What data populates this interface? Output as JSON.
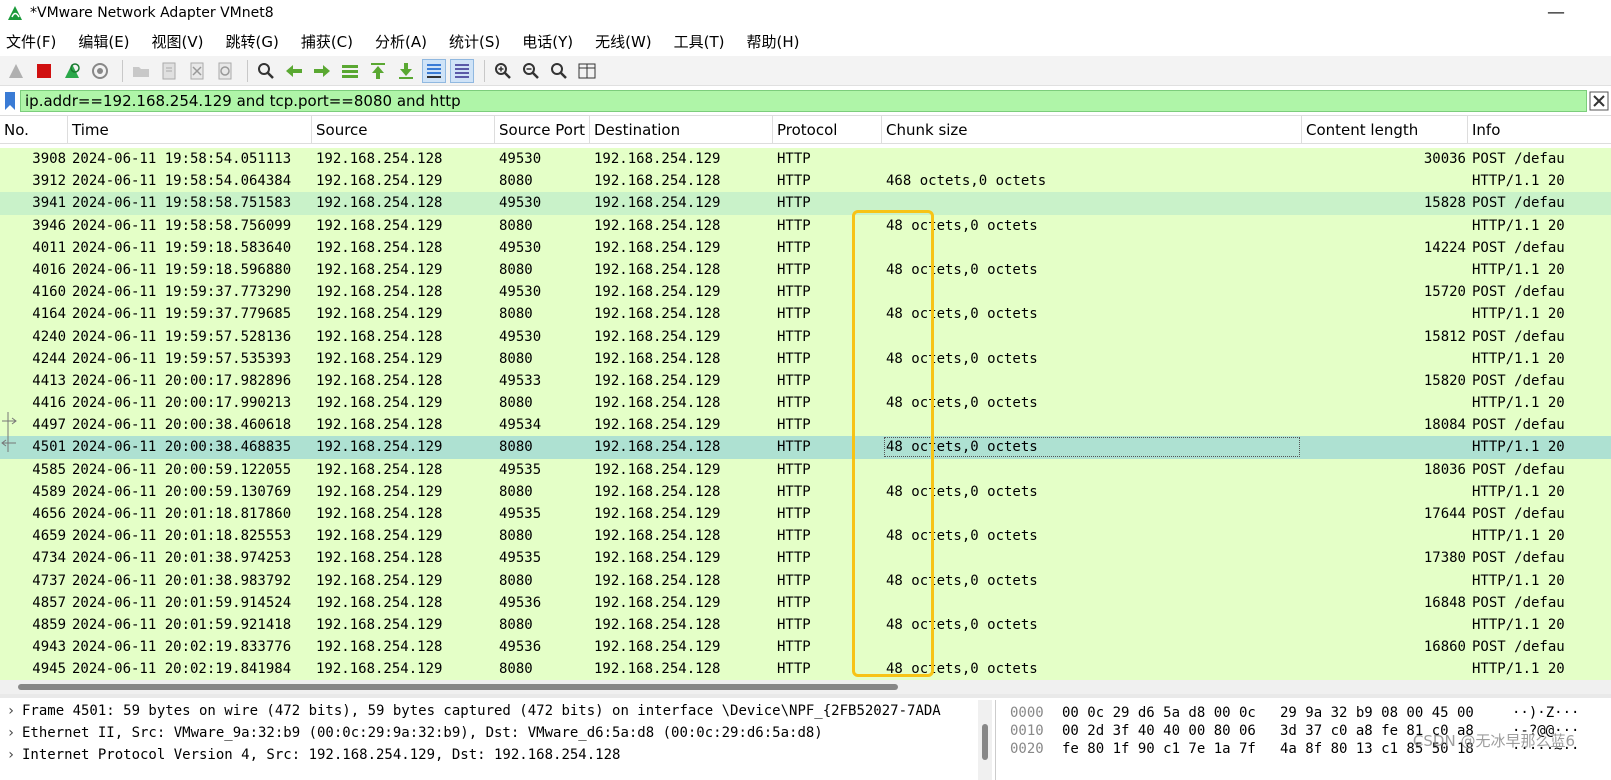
{
  "window": {
    "title": "*VMware Network Adapter VMnet8",
    "minimize": "—"
  },
  "menu": [
    "文件(F)",
    "编辑(E)",
    "视图(V)",
    "跳转(G)",
    "捕获(C)",
    "分析(A)",
    "统计(S)",
    "电话(Y)",
    "无线(W)",
    "工具(T)",
    "帮助(H)"
  ],
  "toolbar_icons": [
    "shark-fin-start-icon",
    "stop-capture-icon",
    "restart-capture-icon",
    "capture-options-icon",
    "open-file-icon",
    "save-file-icon",
    "close-file-icon",
    "reload-file-icon",
    "find-packet-icon",
    "go-back-icon",
    "go-forward-icon",
    "go-to-packet-icon",
    "go-first-icon",
    "go-last-icon",
    "auto-scroll-icon",
    "colorize-icon",
    "zoom-in-icon",
    "zoom-out-icon",
    "zoom-normal-icon",
    "resize-columns-icon"
  ],
  "filter": {
    "value": "ip.addr==192.168.254.129 and tcp.port==8080 and http"
  },
  "columns": {
    "no": "No.",
    "time": "Time",
    "source": "Source",
    "sport": "Source Port",
    "destination": "Destination",
    "protocol": "Protocol",
    "chunk": "Chunk size",
    "clen": "Content length",
    "info": "Info"
  },
  "packets": [
    {
      "no": "3908",
      "time": "2024-06-11 19:58:54.051113",
      "src": "192.168.254.128",
      "sport": "49530",
      "dst": "192.168.254.129",
      "proto": "HTTP",
      "chunk": "",
      "clen": "30036",
      "info": "POST /defau"
    },
    {
      "no": "3912",
      "time": "2024-06-11 19:58:54.064384",
      "src": "192.168.254.129",
      "sport": "8080",
      "dst": "192.168.254.128",
      "proto": "HTTP",
      "chunk": "468 octets,0 octets",
      "clen": "",
      "info": "HTTP/1.1 20"
    },
    {
      "no": "3941",
      "time": "2024-06-11 19:58:58.751583",
      "src": "192.168.254.128",
      "sport": "49530",
      "dst": "192.168.254.129",
      "proto": "HTTP",
      "chunk": "",
      "clen": "15828",
      "info": "POST /defau"
    },
    {
      "no": "3946",
      "time": "2024-06-11 19:58:58.756099",
      "src": "192.168.254.129",
      "sport": "8080",
      "dst": "192.168.254.128",
      "proto": "HTTP",
      "chunk": "48 octets,0 octets",
      "clen": "",
      "info": "HTTP/1.1 20"
    },
    {
      "no": "4011",
      "time": "2024-06-11 19:59:18.583640",
      "src": "192.168.254.128",
      "sport": "49530",
      "dst": "192.168.254.129",
      "proto": "HTTP",
      "chunk": "",
      "clen": "14224",
      "info": "POST /defau"
    },
    {
      "no": "4016",
      "time": "2024-06-11 19:59:18.596880",
      "src": "192.168.254.129",
      "sport": "8080",
      "dst": "192.168.254.128",
      "proto": "HTTP",
      "chunk": "48 octets,0 octets",
      "clen": "",
      "info": "HTTP/1.1 20"
    },
    {
      "no": "4160",
      "time": "2024-06-11 19:59:37.773290",
      "src": "192.168.254.128",
      "sport": "49530",
      "dst": "192.168.254.129",
      "proto": "HTTP",
      "chunk": "",
      "clen": "15720",
      "info": "POST /defau"
    },
    {
      "no": "4164",
      "time": "2024-06-11 19:59:37.779685",
      "src": "192.168.254.129",
      "sport": "8080",
      "dst": "192.168.254.128",
      "proto": "HTTP",
      "chunk": "48 octets,0 octets",
      "clen": "",
      "info": "HTTP/1.1 20"
    },
    {
      "no": "4240",
      "time": "2024-06-11 19:59:57.528136",
      "src": "192.168.254.128",
      "sport": "49530",
      "dst": "192.168.254.129",
      "proto": "HTTP",
      "chunk": "",
      "clen": "15812",
      "info": "POST /defau"
    },
    {
      "no": "4244",
      "time": "2024-06-11 19:59:57.535393",
      "src": "192.168.254.129",
      "sport": "8080",
      "dst": "192.168.254.128",
      "proto": "HTTP",
      "chunk": "48 octets,0 octets",
      "clen": "",
      "info": "HTTP/1.1 20"
    },
    {
      "no": "4413",
      "time": "2024-06-11 20:00:17.982896",
      "src": "192.168.254.128",
      "sport": "49533",
      "dst": "192.168.254.129",
      "proto": "HTTP",
      "chunk": "",
      "clen": "15820",
      "info": "POST /defau"
    },
    {
      "no": "4416",
      "time": "2024-06-11 20:00:17.990213",
      "src": "192.168.254.129",
      "sport": "8080",
      "dst": "192.168.254.128",
      "proto": "HTTP",
      "chunk": "48 octets,0 octets",
      "clen": "",
      "info": "HTTP/1.1 20"
    },
    {
      "no": "4497",
      "time": "2024-06-11 20:00:38.460618",
      "src": "192.168.254.128",
      "sport": "49534",
      "dst": "192.168.254.129",
      "proto": "HTTP",
      "chunk": "",
      "clen": "18084",
      "info": "POST /defau"
    },
    {
      "no": "4501",
      "time": "2024-06-11 20:00:38.468835",
      "src": "192.168.254.129",
      "sport": "8080",
      "dst": "192.168.254.128",
      "proto": "HTTP",
      "chunk": "48 octets,0 octets",
      "clen": "",
      "info": "HTTP/1.1 20"
    },
    {
      "no": "4585",
      "time": "2024-06-11 20:00:59.122055",
      "src": "192.168.254.128",
      "sport": "49535",
      "dst": "192.168.254.129",
      "proto": "HTTP",
      "chunk": "",
      "clen": "18036",
      "info": "POST /defau"
    },
    {
      "no": "4589",
      "time": "2024-06-11 20:00:59.130769",
      "src": "192.168.254.129",
      "sport": "8080",
      "dst": "192.168.254.128",
      "proto": "HTTP",
      "chunk": "48 octets,0 octets",
      "clen": "",
      "info": "HTTP/1.1 20"
    },
    {
      "no": "4656",
      "time": "2024-06-11 20:01:18.817860",
      "src": "192.168.254.128",
      "sport": "49535",
      "dst": "192.168.254.129",
      "proto": "HTTP",
      "chunk": "",
      "clen": "17644",
      "info": "POST /defau"
    },
    {
      "no": "4659",
      "time": "2024-06-11 20:01:18.825553",
      "src": "192.168.254.129",
      "sport": "8080",
      "dst": "192.168.254.128",
      "proto": "HTTP",
      "chunk": "48 octets,0 octets",
      "clen": "",
      "info": "HTTP/1.1 20"
    },
    {
      "no": "4734",
      "time": "2024-06-11 20:01:38.974253",
      "src": "192.168.254.128",
      "sport": "49535",
      "dst": "192.168.254.129",
      "proto": "HTTP",
      "chunk": "",
      "clen": "17380",
      "info": "POST /defau"
    },
    {
      "no": "4737",
      "time": "2024-06-11 20:01:38.983792",
      "src": "192.168.254.129",
      "sport": "8080",
      "dst": "192.168.254.128",
      "proto": "HTTP",
      "chunk": "48 octets,0 octets",
      "clen": "",
      "info": "HTTP/1.1 20"
    },
    {
      "no": "4857",
      "time": "2024-06-11 20:01:59.914524",
      "src": "192.168.254.128",
      "sport": "49536",
      "dst": "192.168.254.129",
      "proto": "HTTP",
      "chunk": "",
      "clen": "16848",
      "info": "POST /defau"
    },
    {
      "no": "4859",
      "time": "2024-06-11 20:01:59.921418",
      "src": "192.168.254.129",
      "sport": "8080",
      "dst": "192.168.254.128",
      "proto": "HTTP",
      "chunk": "48 octets,0 octets",
      "clen": "",
      "info": "HTTP/1.1 20"
    },
    {
      "no": "4943",
      "time": "2024-06-11 20:02:19.833776",
      "src": "192.168.254.128",
      "sport": "49536",
      "dst": "192.168.254.129",
      "proto": "HTTP",
      "chunk": "",
      "clen": "16860",
      "info": "POST /defau"
    },
    {
      "no": "4945",
      "time": "2024-06-11 20:02:19.841984",
      "src": "192.168.254.129",
      "sport": "8080",
      "dst": "192.168.254.128",
      "proto": "HTTP",
      "chunk": "48 octets,0 octets",
      "clen": "",
      "info": "HTTP/1.1 20"
    }
  ],
  "alt_row_no": "3941",
  "selected_row_no": "4501",
  "details": [
    "Frame 4501: 59 bytes on wire (472 bits), 59 bytes captured (472 bits) on interface \\Device\\NPF_{2FB52027-7ADA",
    "Ethernet II, Src: VMware_9a:32:b9 (00:0c:29:9a:32:b9), Dst: VMware_d6:5a:d8 (00:0c:29:d6:5a:d8)",
    "Internet Protocol Version 4, Src: 192.168.254.129, Dst: 192.168.254.128"
  ],
  "hex": [
    {
      "off": "0000",
      "b1": "00 0c 29 d6 5a d8 00 0c",
      "b2": "29 9a 32 b9 08 00 45 00",
      "asc": "··)·Z···"
    },
    {
      "off": "0010",
      "b1": "00 2d 3f 40 40 00 80 06",
      "b2": "3d 37 c0 a8 fe 81 c0 a8",
      "asc": "·-?@@···"
    },
    {
      "off": "0020",
      "b1": "fe 80 1f 90 c1 7e 1a 7f",
      "b2": "4a 8f 80 13 c1 85 50 18",
      "asc": "·····~··"
    }
  ],
  "watermark": "CSDN @无冰早那么蓝6",
  "colors": {
    "row_bg": "#e4ffc7",
    "alt_bg": "#c9f2c9",
    "selected_bg": "#aee1d2",
    "filter_bg": "#aff5a8",
    "highlight": "#f7c316"
  }
}
